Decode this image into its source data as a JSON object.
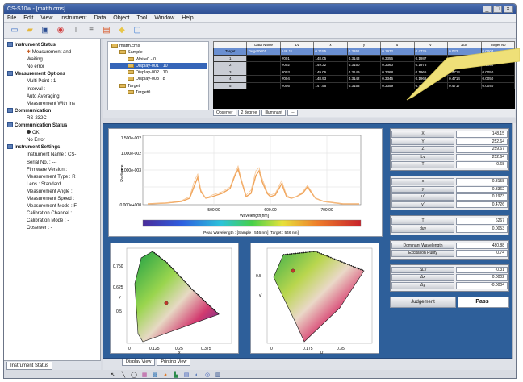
{
  "window": {
    "title": "CS-S10w - [matth.cms]"
  },
  "menu": [
    "File",
    "Edit",
    "View",
    "Instrument",
    "Data",
    "Object",
    "Tool",
    "Window",
    "Help"
  ],
  "toolbar": {
    "icons": [
      "new-icon",
      "open-icon",
      "save-icon",
      "measure-icon",
      "calibrate-icon",
      "chart-icon",
      "color-icon",
      "folder-icon",
      "window-icon"
    ],
    "colors": [
      "#3b6fc4",
      "#e6b73b",
      "#2c4e93",
      "#d23b3b",
      "#555555",
      "#555555",
      "#d85a2b",
      "#e8c64a",
      "#4a86d8"
    ]
  },
  "left_tree": [
    {
      "level": 0,
      "label": "Instrument Status",
      "icon": "sq"
    },
    {
      "level": 1,
      "label": "Measurement and",
      "icon": "gear"
    },
    {
      "level": 1,
      "label": "Waiting",
      "icon": ""
    },
    {
      "level": 1,
      "label": "No error",
      "icon": ""
    },
    {
      "level": 0,
      "label": "Measurement Options",
      "icon": "sq"
    },
    {
      "level": 1,
      "label": "Multi Point : 1",
      "icon": ""
    },
    {
      "level": 1,
      "label": "Interval :",
      "icon": ""
    },
    {
      "level": 1,
      "label": "Auto Averaging",
      "icon": ""
    },
    {
      "level": 1,
      "label": "Measurement With Ins",
      "icon": ""
    },
    {
      "level": 0,
      "label": "Communication",
      "icon": "sq"
    },
    {
      "level": 1,
      "label": "RS-232C",
      "icon": ""
    },
    {
      "level": 0,
      "label": "Communication Status",
      "icon": "sq"
    },
    {
      "level": 1,
      "label": "OK",
      "icon": "dot"
    },
    {
      "level": 1,
      "label": "No Error",
      "icon": ""
    },
    {
      "level": 0,
      "label": "Instrument Settings",
      "icon": "sq"
    },
    {
      "level": 1,
      "label": "Instrument Name : CS-",
      "icon": ""
    },
    {
      "level": 1,
      "label": "Serial No. : ---",
      "icon": ""
    },
    {
      "level": 1,
      "label": "Firmware Version :",
      "icon": ""
    },
    {
      "level": 1,
      "label": "Measurement Type : R",
      "icon": ""
    },
    {
      "level": 1,
      "label": "Lens : Standard",
      "icon": ""
    },
    {
      "level": 1,
      "label": "Measurement Angle :",
      "icon": ""
    },
    {
      "level": 1,
      "label": "Measurement Speed :",
      "icon": ""
    },
    {
      "level": 1,
      "label": "Measurement Mode : F",
      "icon": ""
    },
    {
      "level": 1,
      "label": "Calibration Channel :",
      "icon": ""
    },
    {
      "level": 1,
      "label": "Calibration Mode : -",
      "icon": ""
    },
    {
      "level": 1,
      "label": "Observer : -",
      "icon": ""
    }
  ],
  "left_tab": "Instrument Status",
  "file_tree": [
    {
      "indent": 0,
      "label": "matth.cms"
    },
    {
      "indent": 1,
      "label": "Sample"
    },
    {
      "indent": 2,
      "label": "White0 - 0"
    },
    {
      "indent": 2,
      "label": "Display-001 : 10"
    },
    {
      "indent": 2,
      "label": "Display-002 : 10"
    },
    {
      "indent": 2,
      "label": "Display-003 : 8"
    },
    {
      "indent": 1,
      "label": "Target"
    },
    {
      "indent": 2,
      "label": "Target0"
    }
  ],
  "data_table": {
    "headers": [
      "",
      "Data Name",
      "Lv",
      "x",
      "y",
      "u'",
      "v'",
      "Δuv",
      "Target No"
    ],
    "rows": [
      [
        "Target",
        "Target0001",
        "148.11",
        "0.3155",
        "0.3261",
        "0.1972",
        "0.4725",
        "0.022",
        "0.0004"
      ],
      [
        "1",
        "",
        "#001",
        "148.05",
        "0.3143",
        "0.3356",
        "0.1987",
        "0.4717",
        "0.0050"
      ],
      [
        "2",
        "",
        "#002",
        "149.32",
        "0.3150",
        "0.3360",
        "0.1978",
        "0.4705",
        "0.0050"
      ],
      [
        "3",
        "",
        "#003",
        "149.06",
        "0.3149",
        "0.3368",
        "0.1966",
        "0.4714",
        "0.0050"
      ],
      [
        "4",
        "",
        "#004",
        "148.93",
        "0.3142",
        "0.3346",
        "0.1968",
        "0.4714",
        "0.0050"
      ],
      [
        "5",
        "",
        "#005",
        "147.56",
        "0.3153",
        "0.3359",
        "0.1965",
        "0.4717",
        "0.0040"
      ]
    ]
  },
  "table_footer": [
    "Observer",
    "2 degree",
    "Illuminant",
    "---"
  ],
  "spectrum": {
    "ylabels": [
      "1.500e-002",
      "1.000e-002",
      "5.000e-003",
      "0.000e+000"
    ],
    "xlabels": [
      "500.00",
      "600.00",
      "700.00"
    ],
    "xlabel": "Wavelength[nm]",
    "ylabel": "Radiance",
    "peak": "Peak Wavelength : [Sample : 546 nm] [Target : 546 nm]"
  },
  "cie1": {
    "xlabel": "x",
    "ylabel": "y",
    "ticks_x": [
      "0",
      "0.125",
      "0.25",
      "0.375"
    ],
    "ticks_y": [
      "0.750",
      "0.625",
      "0.5"
    ]
  },
  "cie2": {
    "xlabel": "u'",
    "ylabel": "v'",
    "ticks_x": [
      "0",
      "0.175",
      "0.35"
    ],
    "ticks_y": [
      "0.5"
    ]
  },
  "values": {
    "g1": [
      [
        "X",
        "148.15"
      ],
      [
        "Y",
        "252.64"
      ],
      [
        "Z",
        "259.67"
      ],
      [
        "Lv",
        "252.64"
      ],
      [
        "T",
        "0.68"
      ]
    ],
    "g2": [
      [
        "x",
        "0.3158"
      ],
      [
        "y",
        "0.3362"
      ],
      [
        "u'",
        "0.1973"
      ],
      [
        "v'",
        "0.4726"
      ]
    ],
    "g3": [
      [
        "T",
        "6267"
      ],
      [
        "duv",
        "0.0053"
      ]
    ],
    "g4": [
      [
        "Dominant Wavelength",
        "480.88"
      ],
      [
        "Excitation Purity",
        "0.74"
      ]
    ],
    "g5": [
      [
        "ΔLv",
        "-0.31"
      ],
      [
        "Δx",
        "0.0002"
      ],
      [
        "Δy",
        "-0.0004"
      ]
    ],
    "judgement": {
      "label": "Judgement",
      "value": "Pass"
    }
  },
  "bottom_tabs": [
    "Display View",
    "Printing View"
  ],
  "bottom_toolbar": [
    "pointer-icon",
    "line-icon",
    "ellipse-icon",
    "graph-icon",
    "grid-icon",
    "color-icon",
    "bar-icon",
    "table-icon",
    "cie-icon",
    "ring-icon",
    "stat-icon"
  ]
}
